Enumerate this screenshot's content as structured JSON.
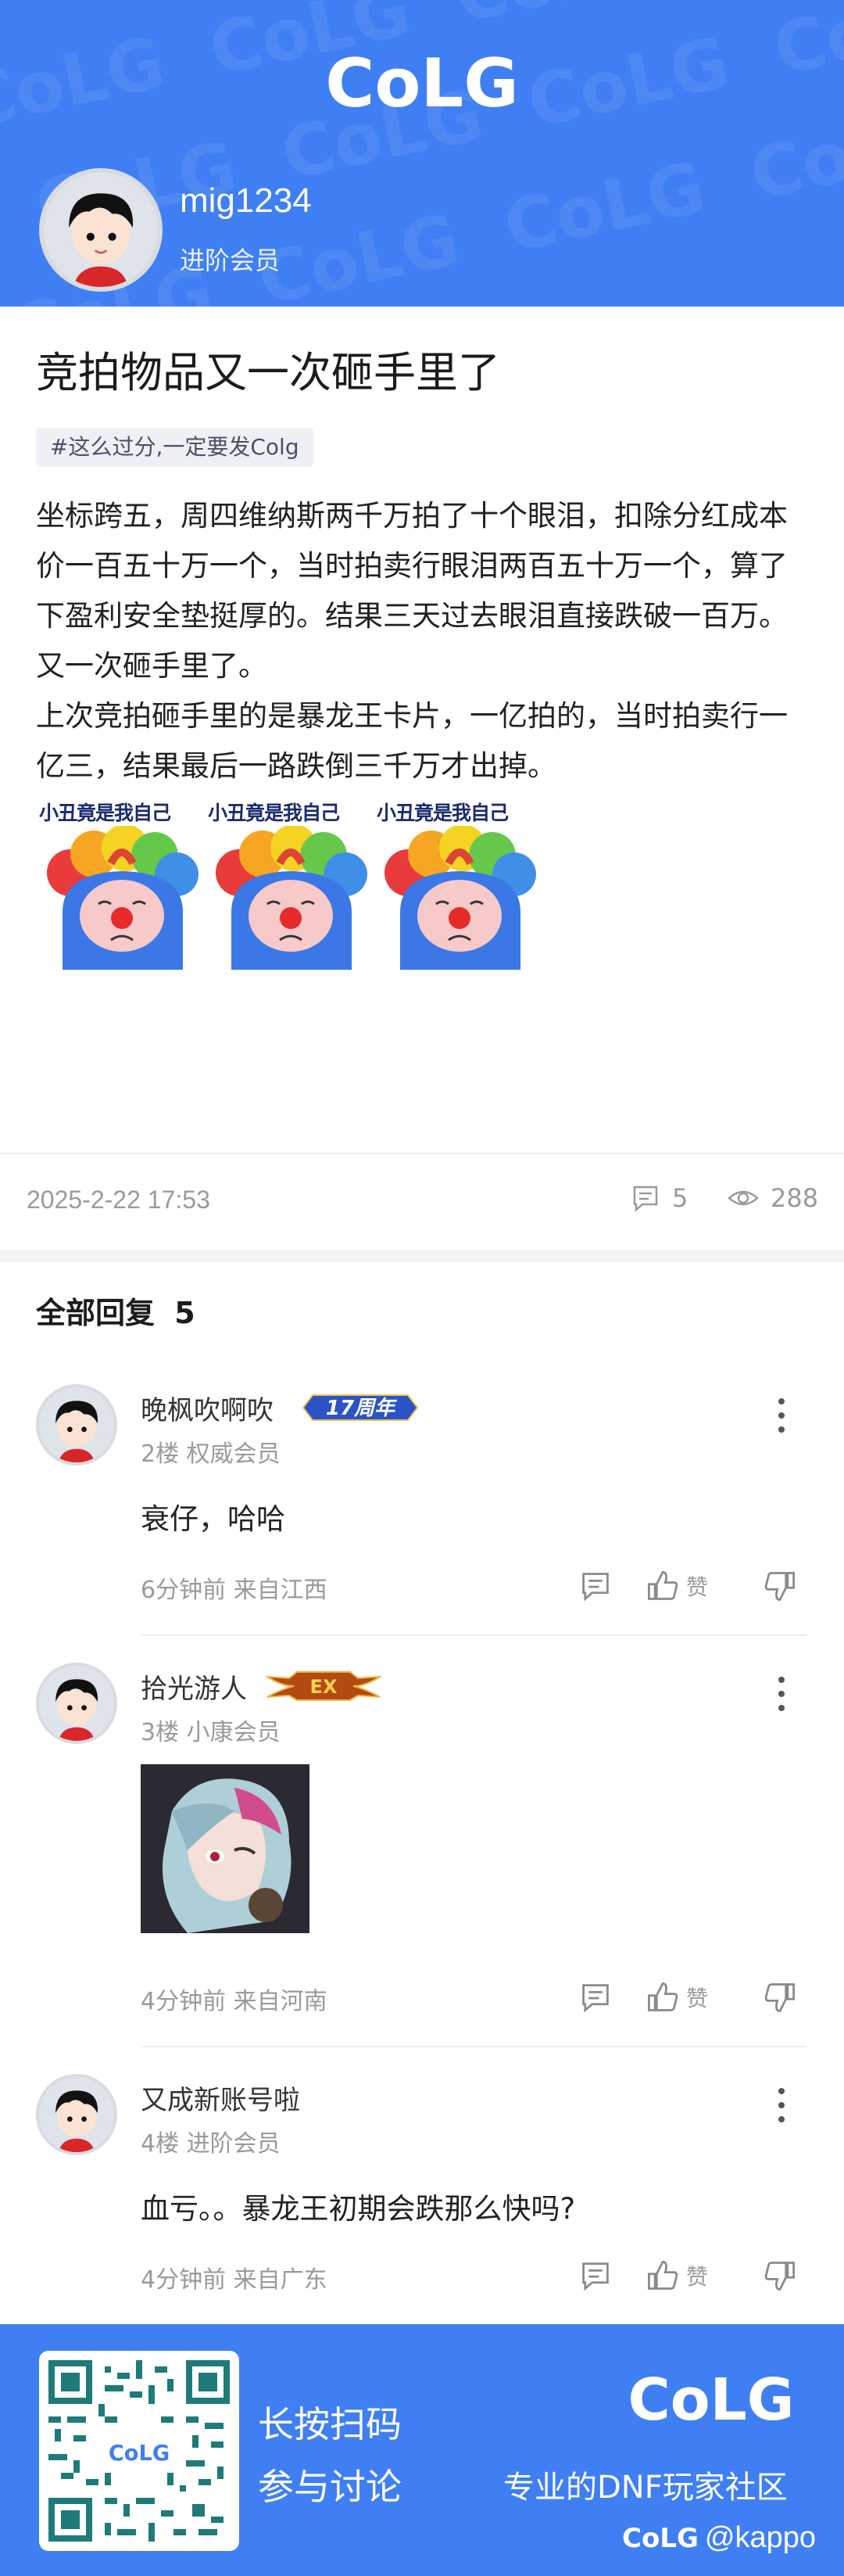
{
  "brand": {
    "logo_text": "CoLG",
    "accent": "#3f7ff3"
  },
  "author": {
    "name": "mig1234",
    "title": "进阶会员"
  },
  "post": {
    "title": "竞拍物品又一次砸手里了",
    "tag": "#这么过分,一定要发Colg",
    "paragraphs": [
      "坐标跨五，周四维纳斯两千万拍了十个眼泪，扣除分红成本价一百五十万一个，当时拍卖行眼泪两百五十万一个，算了下盈利安全垫挺厚的。结果三天过去眼泪直接跌破一百万。又一次砸手里了。",
      "上次竞拍砸手里的是暴龙王卡片，一亿拍的，当时拍卖行一亿三，结果最后一路跌倒三千万才出掉。"
    ],
    "sticker_caption": "小丑竟是我自己",
    "time": "2025-2-22 17:53",
    "comment_count": "5",
    "view_count": "288"
  },
  "replies_header": {
    "label": "全部回复",
    "count": "5"
  },
  "replies": [
    {
      "name": "晚枫吹啊吹",
      "badge": "17周年",
      "floor": "2楼 权威会员",
      "text": "衰仔，哈哈",
      "meta": "6分钟前 来自江西",
      "like": "赞"
    },
    {
      "name": "拾光游人",
      "badge": "EX",
      "floor": "3楼 小康会员",
      "text": "",
      "meta": "4分钟前 来自河南",
      "like": "赞"
    },
    {
      "name": "又成新账号啦",
      "badge": "",
      "floor": "4楼 进阶会员",
      "text": "血亏。。暴龙王初期会跌那么快吗?",
      "meta": "4分钟前 来自广东",
      "like": "赞"
    }
  ],
  "footer": {
    "line1": "长按扫码",
    "line2": "参与讨论",
    "slogan": "专业的DNF玩家社区",
    "bottom_logo": "CoLG",
    "bottom_handle": "@kappo",
    "qr_logo": "CoLG"
  }
}
